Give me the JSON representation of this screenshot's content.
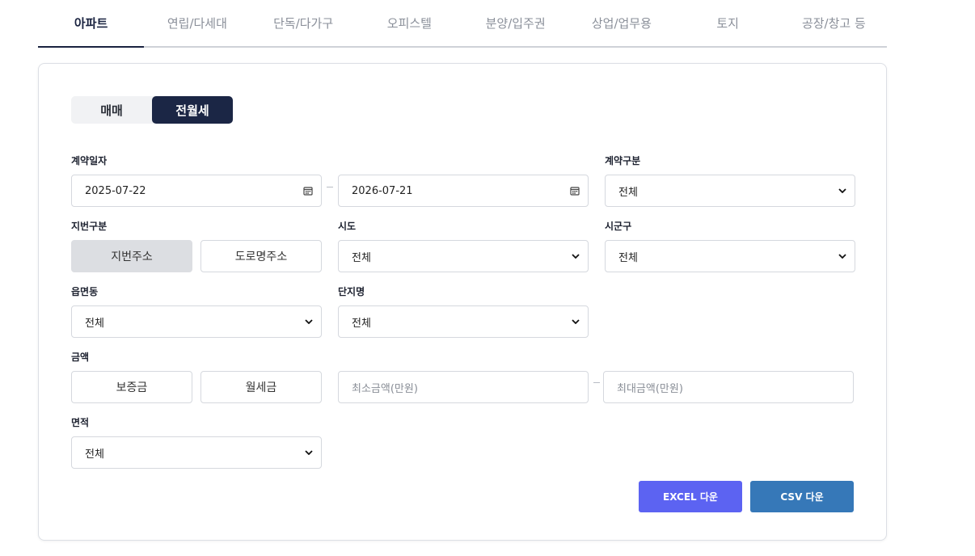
{
  "tabs": [
    {
      "label": "아파트",
      "active": true
    },
    {
      "label": "연립/다세대",
      "active": false
    },
    {
      "label": "단독/다가구",
      "active": false
    },
    {
      "label": "오피스텔",
      "active": false
    },
    {
      "label": "분양/입주권",
      "active": false
    },
    {
      "label": "상업/업무용",
      "active": false
    },
    {
      "label": "토지",
      "active": false
    },
    {
      "label": "공장/창고 등",
      "active": false
    }
  ],
  "trade_toggle": {
    "sale_label": "매매",
    "lease_label": "전월세",
    "selected": "전월세"
  },
  "contract_date": {
    "label": "계약일자",
    "start": "2025-07-22",
    "end": "2026-07-21"
  },
  "contract_type": {
    "label": "계약구분",
    "value": "전체"
  },
  "lot_type": {
    "label": "지번구분",
    "lot_label": "지번주소",
    "road_label": "도로명주소",
    "selected": "지번주소"
  },
  "sido": {
    "label": "시도",
    "value": "전체"
  },
  "sigungu": {
    "label": "시군구",
    "value": "전체"
  },
  "eupmyeondong": {
    "label": "읍면동",
    "value": "전체"
  },
  "complex": {
    "label": "단지명",
    "value": "전체"
  },
  "amount": {
    "label": "금액",
    "deposit_label": "보증금",
    "monthly_label": "월세금",
    "min_placeholder": "최소금액(만원)",
    "max_placeholder": "최대금액(만원)"
  },
  "area": {
    "label": "면적",
    "value": "전체"
  },
  "downloads": {
    "excel_label": "EXCEL 다운",
    "csv_label": "CSV 다운",
    "excel_color": "#5c63f2",
    "csv_color": "#3678b8"
  },
  "colors": {
    "active_navy": "#1b2645",
    "selected_gray": "#dcdee2"
  }
}
